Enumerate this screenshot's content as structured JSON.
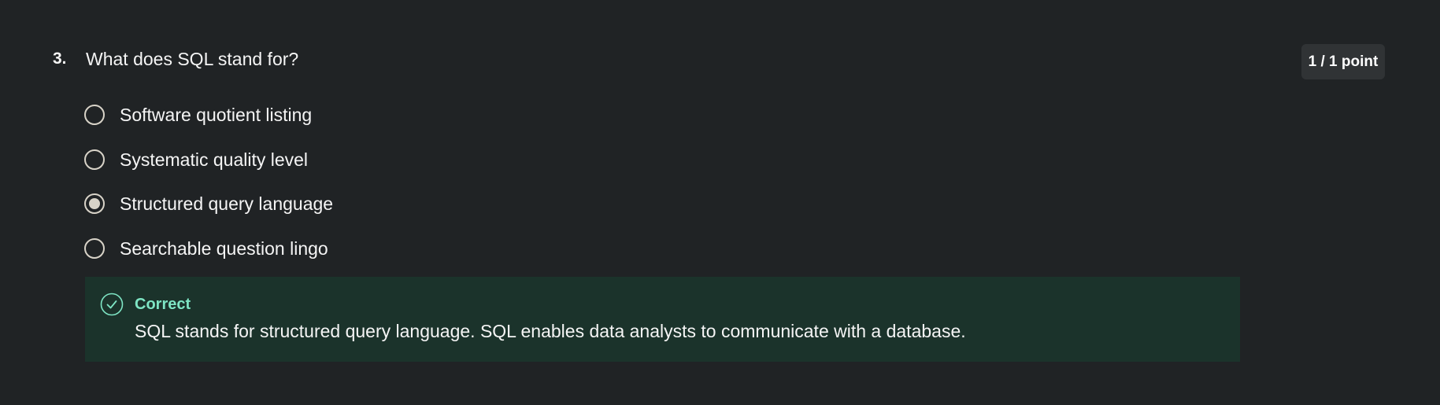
{
  "question": {
    "number": "3.",
    "text": "What does SQL stand for?"
  },
  "score": {
    "label": "1 / 1 point"
  },
  "options": [
    {
      "label": "Software quotient listing",
      "selected": false
    },
    {
      "label": "Systematic quality level",
      "selected": false
    },
    {
      "label": "Structured query language",
      "selected": true
    },
    {
      "label": "Searchable question lingo",
      "selected": false
    }
  ],
  "feedback": {
    "title": "Correct",
    "text": "SQL stands for structured query language. SQL enables data analysts to communicate with a database.",
    "icon": "check-circle-icon"
  },
  "colors": {
    "background": "#202325",
    "feedback_background": "#1b332b",
    "correct_accent": "#7ee5c4",
    "radio": "#d8d3c8"
  }
}
